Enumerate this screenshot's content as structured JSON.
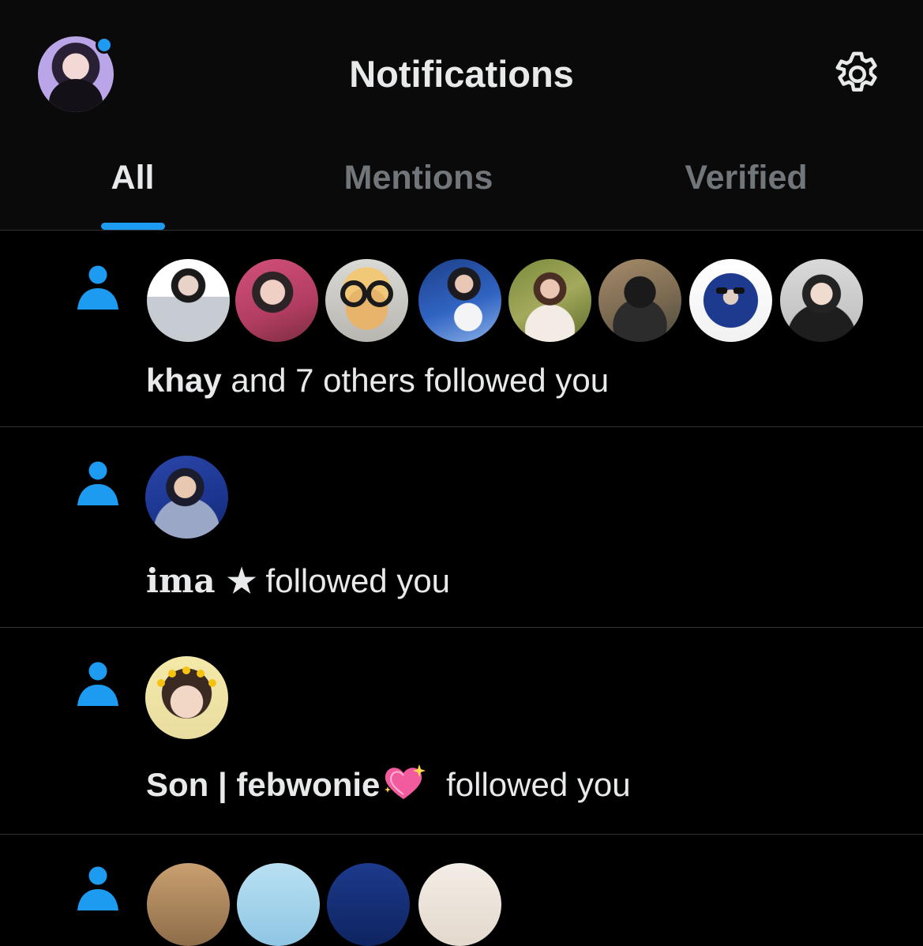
{
  "header": {
    "title": "Notifications",
    "profile_avatar_icon": "profile-avatar",
    "settings_icon": "gear-icon",
    "notification_dot_color": "#1d9bf0"
  },
  "tabs": [
    {
      "label": "All",
      "active": true
    },
    {
      "label": "Mentions",
      "active": false
    },
    {
      "label": "Verified",
      "active": false
    }
  ],
  "accent_color": "#1d9bf0",
  "notifications": [
    {
      "icon": "person-icon",
      "avatar_count": 8,
      "name": "khay",
      "text": " and 7 others followed you"
    },
    {
      "icon": "person-icon",
      "avatar_count": 1,
      "name": "ima ★",
      "text": " followed you"
    },
    {
      "icon": "person-icon",
      "avatar_count": 1,
      "name": "Son | febwonie",
      "emoji": "sparkling-heart-icon",
      "text": " followed you"
    },
    {
      "icon": "person-icon",
      "avatar_count": 4,
      "name": "",
      "text": ""
    }
  ]
}
